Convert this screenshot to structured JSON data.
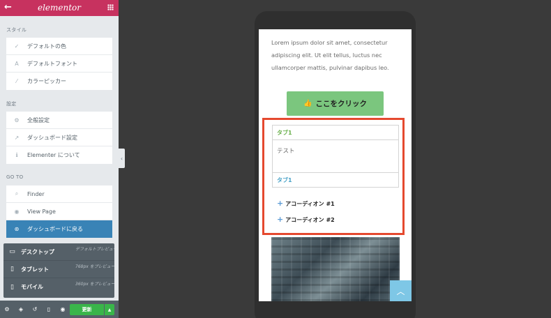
{
  "topbar": {
    "logo": "elementor"
  },
  "sections": {
    "style": {
      "title": "スタイル",
      "items": [
        {
          "label": "デフォルトの色",
          "icon": "brush-icon",
          "glyph": "✓"
        },
        {
          "label": "デフォルトフォント",
          "icon": "font-icon",
          "glyph": "A"
        },
        {
          "label": "カラーピッカー",
          "icon": "eyedropper-icon",
          "glyph": "⁄"
        }
      ]
    },
    "settings": {
      "title": "設定",
      "items": [
        {
          "label": "全般設定",
          "icon": "cogs-icon",
          "glyph": "⚙"
        },
        {
          "label": "ダッシュボード設定",
          "icon": "external-link-icon",
          "glyph": "↗"
        },
        {
          "label": "Elementer について",
          "icon": "info-icon",
          "glyph": "ℹ"
        }
      ]
    },
    "goto": {
      "title": "GO TO",
      "items": [
        {
          "label": "Finder",
          "icon": "search-icon",
          "glyph": "⌕"
        },
        {
          "label": "View Page",
          "icon": "eye-icon",
          "glyph": "◉"
        },
        {
          "label": "ダッシュボードに戻る",
          "icon": "wordpress-icon",
          "glyph": "⊛"
        }
      ]
    }
  },
  "responsive": [
    {
      "label": "デスクトップ",
      "hint": "デフォルトプレビュー",
      "icon": "desktop-icon",
      "glyph": "▭"
    },
    {
      "label": "タブレット",
      "hint": "768px をプレビュー",
      "icon": "tablet-icon",
      "glyph": "▯"
    },
    {
      "label": "モバイル",
      "hint": "360px をプレビュー",
      "icon": "mobile-icon",
      "glyph": "▯"
    }
  ],
  "bottombar": {
    "update_label": "更新"
  },
  "preview": {
    "paragraph": "Lorem ipsum dolor sit amet, consectetur adipiscing elit. Ut elit tellus, luctus nec ullamcorper mattis, pulvinar dapibus leo.",
    "button_label": "ここをクリック",
    "tab1_title": "タブ1",
    "tab_content": "テスト",
    "tab2_title": "タブ1",
    "accordion1": "アコーディオン #1",
    "accordion2": "アコーディオン #2"
  },
  "colors": {
    "brand": "#c7325f",
    "accent": "#3983b6",
    "update": "#39b54a",
    "highlight": "#e5492f"
  }
}
